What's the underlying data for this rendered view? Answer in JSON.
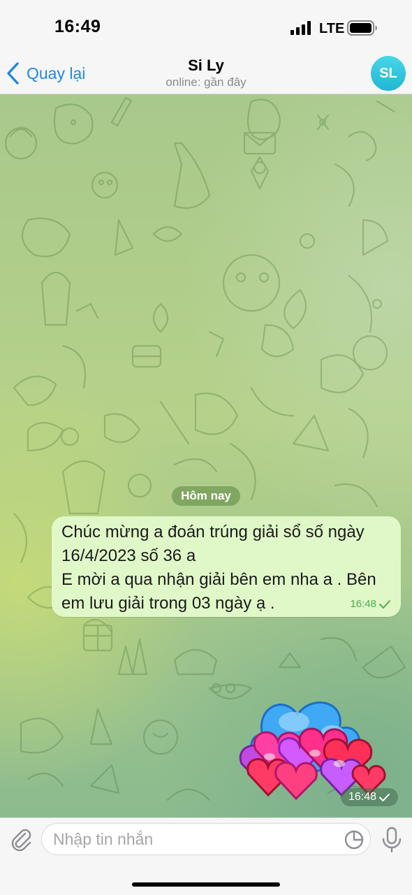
{
  "status_bar": {
    "time": "16:49",
    "network": "LTE",
    "signal_icon": "signal-bars-icon",
    "battery_icon": "battery-icon"
  },
  "header": {
    "back_label": "Quay lại",
    "back_icon": "chevron-left-icon",
    "title": "Si Ly",
    "status": "online: gần đây",
    "avatar_initials": "SL",
    "avatar_color": "#2cc5dd"
  },
  "chat": {
    "date_label": "Hôm nay",
    "messages": [
      {
        "lines": [
          "Chúc mừng a đoán trúng giải sổ số ngày",
          "16/4/2023 số 36 a",
          "E mời a qua nhận giải bên em nha a . Bên",
          "em lưu giải trong 03 ngày ạ ."
        ],
        "time": "16:48",
        "read_icon": "check-icon"
      }
    ],
    "sticker": {
      "name": "hearts-sticker",
      "time": "16:48",
      "read_icon": "check-icon"
    }
  },
  "composer": {
    "placeholder": "Nhập tin nhắn",
    "value": "",
    "attach_icon": "paperclip-icon",
    "sticker_icon": "sticker-icon",
    "mic_icon": "microphone-icon"
  },
  "colors": {
    "accent": "#1e88e5",
    "outgoing_bubble": "#e0f8c8",
    "read_check": "#4caf50"
  }
}
